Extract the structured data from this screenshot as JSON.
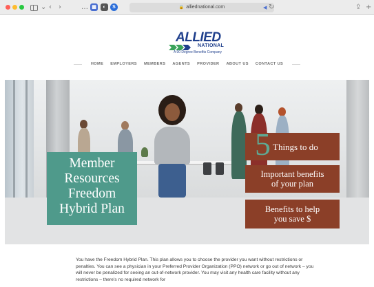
{
  "browser": {
    "url": "alliednational.com",
    "reader_label": "◀▶",
    "ext_icons": [
      "…",
      "▦",
      "◐",
      "S"
    ]
  },
  "logo": {
    "brand": "ALLIED",
    "sub": "NATIONAL",
    "tagline": "A 90 Degree Benefits Company"
  },
  "nav": {
    "items": [
      "HOME",
      "EMPLOYERS",
      "MEMBERS",
      "AGENTS",
      "PROVIDER",
      "ABOUT US",
      "CONTACT US"
    ]
  },
  "hero": {
    "member_box": {
      "line1": "Member",
      "line2": "Resources",
      "line3": "Freedom",
      "line4": "Hybrid Plan"
    },
    "things_box": {
      "number": "5",
      "text": "Things to do"
    },
    "important_box": {
      "line1": "Important benefits",
      "line2": "of your plan"
    },
    "benefits_box": {
      "line1": "Benefits to help",
      "line2": "you save $"
    }
  },
  "content": {
    "paragraph": "You have the Freedom Hybrid Plan. This plan allows you to choose the provider you want without restrictions or penalties. You can see a physician in your Preferred Provider Organization (PPO) network or go out of network – you will never be penalized for seeing an out-of-network provider. You may visit any health care facility without any restrictions – there's no required network for"
  },
  "colors": {
    "teal": "#4f9a8b",
    "rust": "#8b3f28",
    "brand_blue": "#1f3f8c",
    "brand_green": "#3aa35b"
  }
}
